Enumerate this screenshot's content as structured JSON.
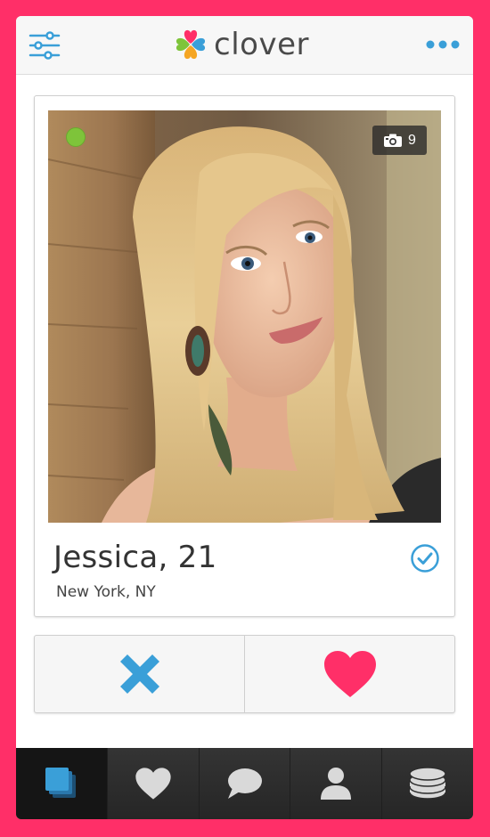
{
  "app": {
    "name": "clover"
  },
  "header": {
    "filter_icon": "sliders-icon",
    "more_icon": "more-dots-icon",
    "logo_icon": "clover-logo-icon"
  },
  "profile": {
    "name_age": "Jessica, 21",
    "location": "New York, NY",
    "photo_count": "9",
    "online": true,
    "verified": true
  },
  "actions": [
    {
      "icon": "x-icon"
    },
    {
      "icon": "heart-icon"
    }
  ],
  "tabbar": [
    {
      "icon": "cards-stack-icon",
      "active": true
    },
    {
      "icon": "heart-icon",
      "active": false
    },
    {
      "icon": "chat-bubble-icon",
      "active": false
    },
    {
      "icon": "person-icon",
      "active": false
    },
    {
      "icon": "coins-stack-icon",
      "active": false
    }
  ],
  "colors": {
    "frame": "#ff2f68",
    "accent_blue": "#3a9fd8",
    "like_pink": "#ff2f68",
    "online_green": "#7ec43a"
  }
}
